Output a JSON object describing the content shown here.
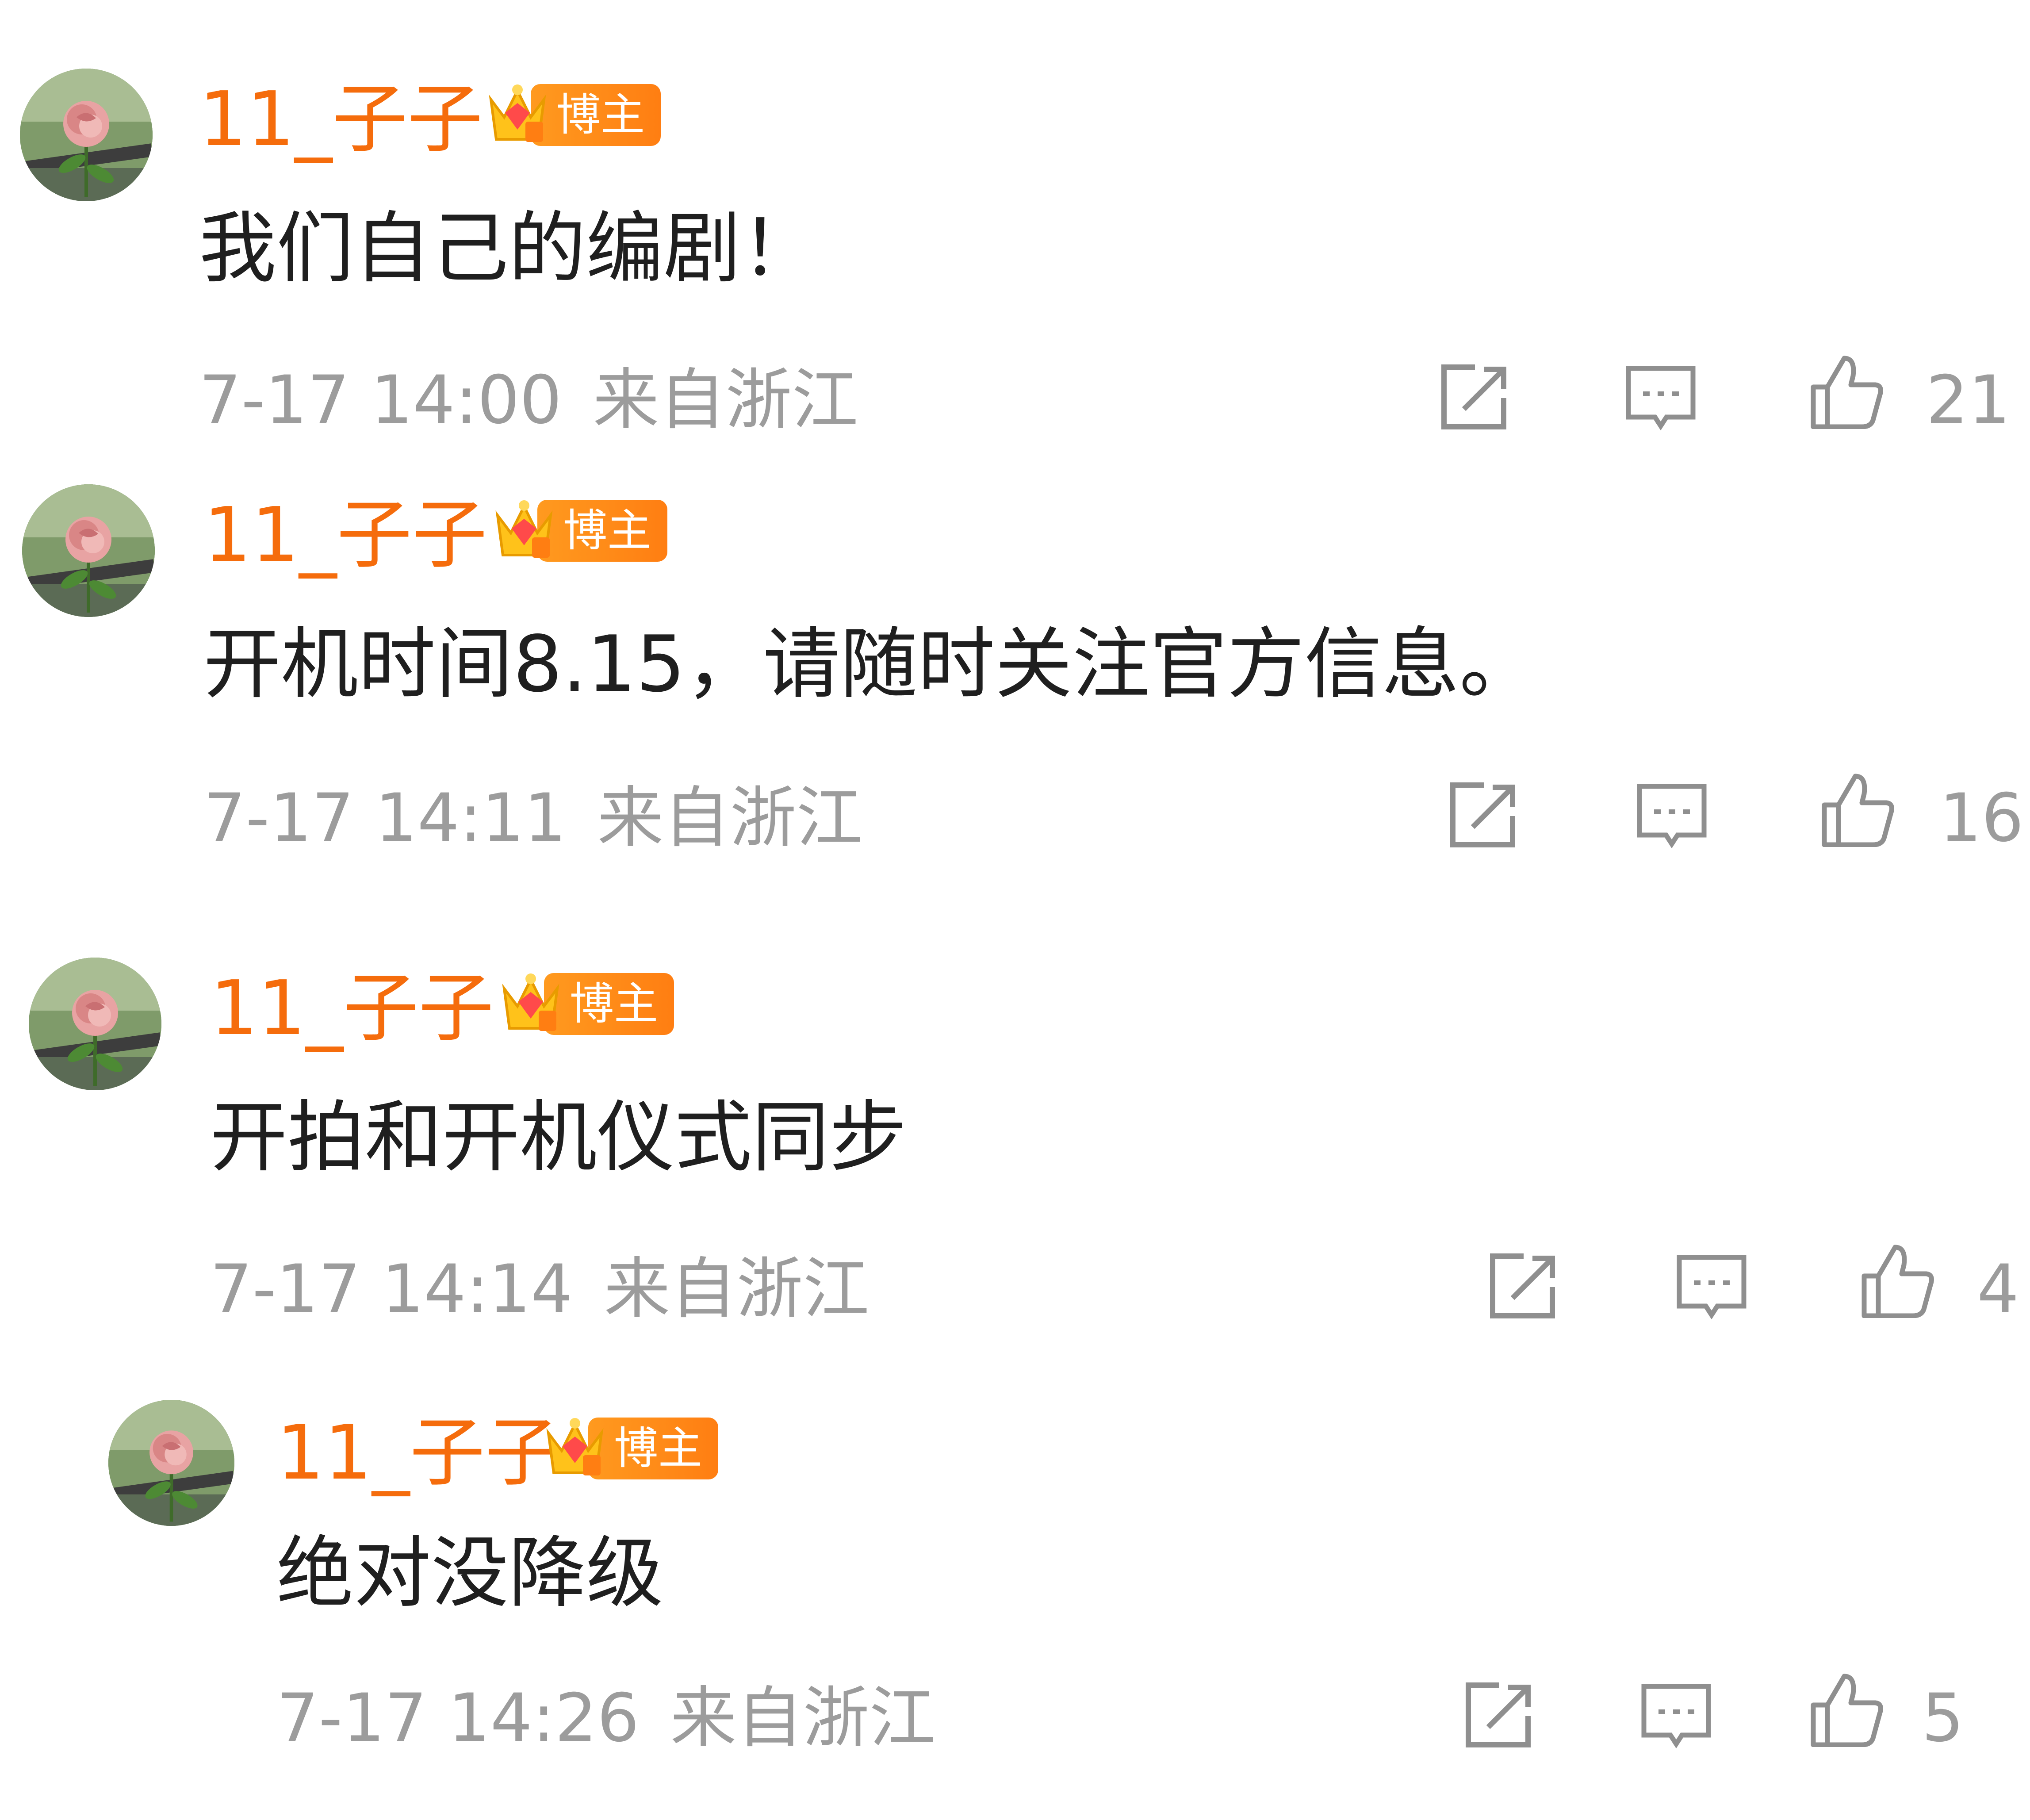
{
  "comments": [
    {
      "username": "11_子子",
      "badge": "博主",
      "badge_level": "2",
      "content": "我们自己的编剧！",
      "timestamp": "7-17 14:00",
      "location": "来自浙江",
      "likes": "21"
    },
    {
      "username": "11_子子",
      "badge": "博主",
      "badge_level": "2",
      "content": "开机时间8.15，请随时关注官方信息。",
      "timestamp": "7-17 14:11",
      "location": "来自浙江",
      "likes": "16"
    },
    {
      "username": "11_子子",
      "badge": "博主",
      "badge_level": "2",
      "content": "开拍和开机仪式同步",
      "timestamp": "7-17 14:14",
      "location": "来自浙江",
      "likes": "4"
    },
    {
      "username": "11_子子",
      "badge": "博主",
      "badge_level": "2",
      "content": "绝对没降级",
      "timestamp": "7-17 14:26",
      "location": "来自浙江",
      "likes": "5"
    }
  ],
  "colors": {
    "username": "#f56c0c",
    "badge_bg": "#ff8a18",
    "content": "#1f1f1f",
    "meta": "#9c9c9c"
  },
  "icons": [
    "share-icon",
    "reply-icon",
    "like-icon",
    "crown-icon",
    "avatar-rose"
  ]
}
